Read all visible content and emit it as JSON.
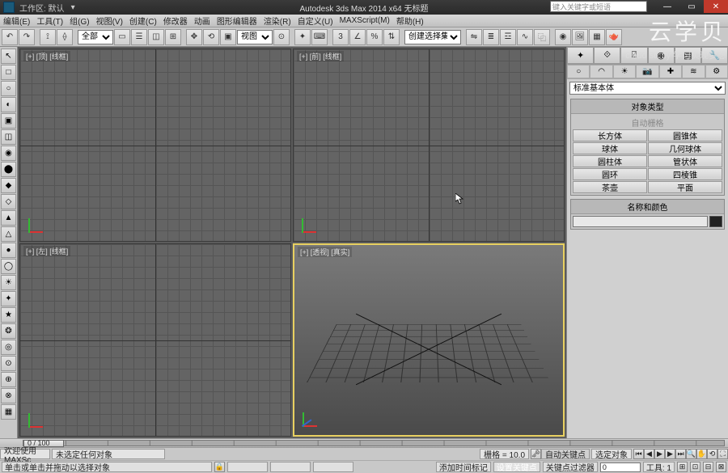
{
  "titlebar": {
    "workspace_label": "工作区: 默认",
    "title": "Autodesk 3ds Max 2014 x64   无标题",
    "search_placeholder": "键入关键字或短语"
  },
  "watermark": {
    "big": "云学贝",
    "small": "cloud study   学习实现梦想"
  },
  "menu": {
    "edit": "编辑(E)",
    "tools": "工具(T)",
    "group": "组(G)",
    "views": "视图(V)",
    "create": "创建(C)",
    "modifiers": "修改器",
    "animation": "动画",
    "graph": "图形编辑器",
    "render": "渲染(R)",
    "custom": "自定义(U)",
    "maxscript": "MAXScript(M)",
    "help": "帮助(H)"
  },
  "toolbar": {
    "sel_filter": "全部",
    "refcoord": "视图",
    "named_sel": "创建选择集"
  },
  "left_icons": [
    "↖",
    "□",
    "○",
    "◐",
    "▣",
    "◫",
    "◉",
    "⬤",
    "◆",
    "◇",
    "▲",
    "△",
    "●",
    "◯",
    "☀",
    "✦",
    "★",
    "❂",
    "◎",
    "⊙",
    "⊕",
    "⊗",
    "▦"
  ],
  "viewports": {
    "top": "[+] [顶] [线框]",
    "front": "[+] [前] [线框]",
    "left": "[+] [左] [线框]",
    "persp": "[+] [透视] [真实]"
  },
  "cmd": {
    "dropdown": "标准基本体",
    "rollout_type": "对象类型",
    "autogrid": "自动栅格",
    "prims": {
      "box": "长方体",
      "cone": "圆锥体",
      "sphere": "球体",
      "geosphere": "几何球体",
      "cylinder": "圆柱体",
      "tube": "管状体",
      "torus": "圆环",
      "pyramid": "四棱锥",
      "teapot": "茶壶",
      "plane": "平面"
    },
    "rollout_name": "名称和颜色"
  },
  "time": {
    "label": "0 / 100"
  },
  "status": {
    "welcome": "欢迎使用 MAXSc",
    "sel_none": "未选定任何对象",
    "hint": "单击或单击并拖动以选择对象",
    "grid_label": "栅格 = 10.0",
    "autokey": "自动关键点",
    "selected_lock": "选定对象",
    "addtime": "添加时间标记",
    "setkey": "设置关键点",
    "keyfilter": "关键点过滤器",
    "tools_label": "工具: 1"
  }
}
